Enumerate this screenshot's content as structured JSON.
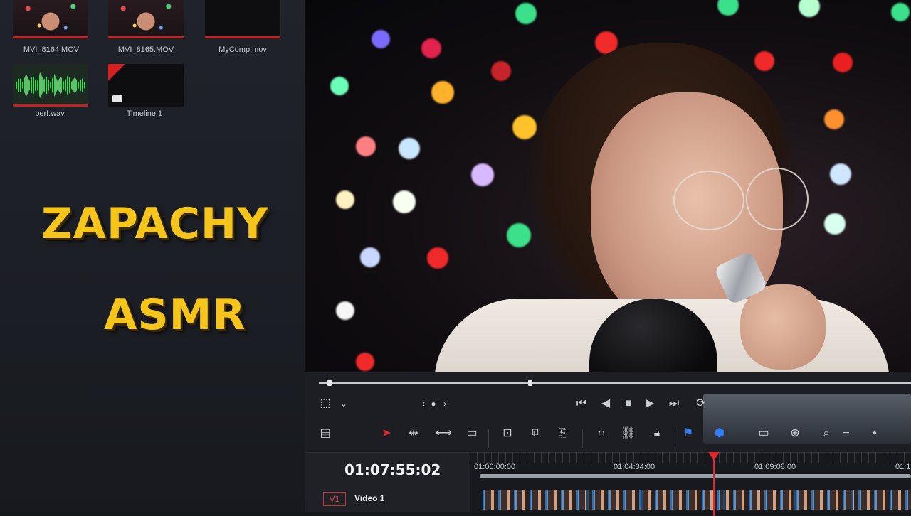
{
  "media_pool": {
    "clips": [
      {
        "name": "MVI_8164.MOV",
        "kind": "video"
      },
      {
        "name": "MVI_8165.MOV",
        "kind": "video"
      },
      {
        "name": "MyComp.mov",
        "kind": "video"
      },
      {
        "name": "perf.wav",
        "kind": "audio"
      },
      {
        "name": "Timeline 1",
        "kind": "timeline"
      }
    ]
  },
  "overlay": {
    "line1": "ZAPACHY",
    "line2": "ASMR",
    "color": "#f6c51b"
  },
  "viewer": {
    "transport_icons": [
      "transform-icon",
      "chevron-down-icon",
      "prev-frame-icon",
      "dot-icon",
      "next-frame-icon",
      "skip-start-icon",
      "play-reverse-icon",
      "stop-icon",
      "play-icon",
      "skip-end-icon",
      "loop-icon"
    ]
  },
  "toolbar": {
    "icons": [
      "timeline-view-icon",
      "selection-arrow-icon",
      "trim-icon",
      "dynamic-trim-icon",
      "blade-icon",
      "insert-icon",
      "overwrite-icon",
      "replace-icon",
      "snapping-icon",
      "link-icon",
      "lock-icon",
      "flag-icon",
      "marker-icon",
      "zoom-full-icon",
      "zoom-detail-icon",
      "zoom-custom-icon",
      "zoom-out-icon",
      "zoom-slider-icon"
    ],
    "accent": "#e5252b"
  },
  "timeline": {
    "timecode": "01:07:55:02",
    "ruler": [
      "01:00:00:00",
      "01:04:34:00",
      "01:09:08:00",
      "01:1"
    ],
    "track": {
      "id": "V1",
      "name": "Video 1"
    },
    "playhead_color": "#e5252b"
  }
}
